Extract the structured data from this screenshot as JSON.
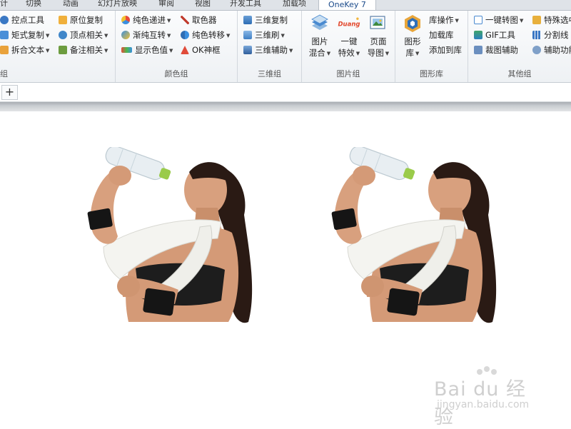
{
  "tabs": [
    "计",
    "切换",
    "动画",
    "幻灯片放映",
    "审阅",
    "视图",
    "开发工具",
    "加载项",
    "OneKey 7"
  ],
  "groups": {
    "g1": {
      "label": "组",
      "items": [
        {
          "label": "控点工具",
          "icon": "handle-tool-icon",
          "dd": false
        },
        {
          "label": "矩式复制",
          "icon": "matrix-copy-icon",
          "dd": true
        },
        {
          "label": "拆合文本",
          "icon": "split-text-icon",
          "dd": true
        },
        {
          "label": "原位复制",
          "icon": "inplace-copy-icon",
          "dd": false
        },
        {
          "label": "顶点相关",
          "icon": "vertex-icon",
          "dd": true
        },
        {
          "label": "备注相关",
          "icon": "notes-icon",
          "dd": true
        }
      ]
    },
    "color": {
      "label": "颜色组",
      "items": [
        {
          "label": "纯色递进",
          "icon": "solid-color-icon",
          "dd": true
        },
        {
          "label": "渐纯互转",
          "icon": "gradient-swap-icon",
          "dd": true
        },
        {
          "label": "显示色值",
          "icon": "rgb-value-icon",
          "dd": true
        },
        {
          "label": "取色器",
          "icon": "eyedropper-icon",
          "dd": false
        },
        {
          "label": "纯色转移",
          "icon": "color-transfer-icon",
          "dd": true
        },
        {
          "label": "OK神框",
          "icon": "ok-frame-icon",
          "dd": false
        }
      ]
    },
    "threed": {
      "label": "三维组",
      "items": [
        {
          "label": "三维复制",
          "icon": "3d-copy-icon",
          "dd": false
        },
        {
          "label": "三维刷",
          "icon": "3d-brush-icon",
          "dd": true
        },
        {
          "label": "三维辅助",
          "icon": "3d-assist-icon",
          "dd": true
        }
      ]
    },
    "pic": {
      "label": "图片组",
      "big": [
        {
          "line1": "图片",
          "line2": "混合",
          "icon": "image-blend-icon"
        },
        {
          "line1": "一键",
          "line2": "特效",
          "icon": "duang-effect-icon",
          "badge": "Duang"
        },
        {
          "line1": "页面",
          "line2": "导图",
          "icon": "page-export-icon"
        }
      ]
    },
    "shapelib": {
      "label": "图形库",
      "big": {
        "line1": "图形",
        "line2": "库",
        "icon": "shape-library-icon"
      },
      "items": [
        {
          "label": "库操作",
          "dd": true
        },
        {
          "label": "加载库",
          "dd": false
        },
        {
          "label": "添加到库",
          "dd": false
        }
      ]
    },
    "other": {
      "label": "其他组",
      "items": [
        {
          "label": "一键转图",
          "icon": "convert-to-image-icon",
          "dd": true
        },
        {
          "label": "GIF工具",
          "icon": "gif-tool-icon",
          "dd": false
        },
        {
          "label": "裁图辅助",
          "icon": "crop-assist-icon",
          "dd": false
        },
        {
          "label": "特殊选中",
          "icon": "special-select-icon",
          "dd": false
        },
        {
          "label": "分割线",
          "icon": "divider-line-icon",
          "dd": false
        },
        {
          "label": "辅助功能",
          "icon": "assist-function-icon",
          "dd": false
        }
      ]
    }
  },
  "slide_tabs": {
    "add_label": "+"
  },
  "watermark": {
    "logo": "Bai du 经验",
    "url": "jingyan.baidu.com"
  },
  "colors": {
    "accent": "#1a4a8a",
    "ribbon_bg": "#f5f7f9",
    "skin": "#d8a07e",
    "hair": "#2a1a14",
    "towel": "#f4f4f0"
  }
}
